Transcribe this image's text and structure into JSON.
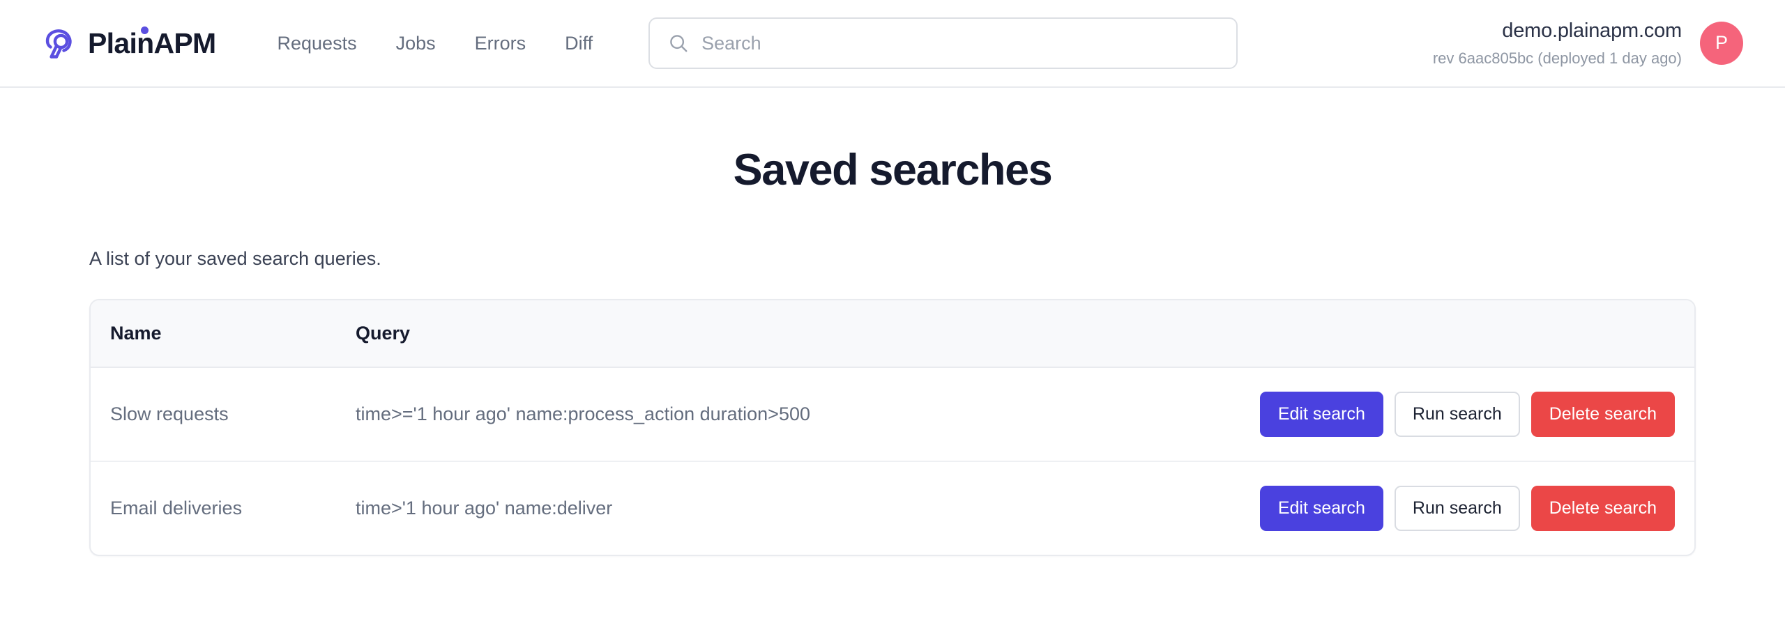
{
  "header": {
    "brand_name": "PlainAPM",
    "brand_logo_icon": "plainapm-logo-icon",
    "nav": [
      {
        "label": "Requests"
      },
      {
        "label": "Jobs"
      },
      {
        "label": "Errors"
      },
      {
        "label": "Diff"
      }
    ],
    "search": {
      "icon": "search-icon",
      "placeholder": "Search",
      "value": ""
    },
    "account": {
      "host": "demo.plainapm.com",
      "revision": "rev 6aac805bc (deployed 1 day ago)",
      "avatar_initial": "P",
      "avatar_color": "#f5647b"
    }
  },
  "main": {
    "title": "Saved searches",
    "description": "A list of your saved search queries.",
    "table": {
      "columns": [
        "Name",
        "Query",
        ""
      ],
      "rows": [
        {
          "name": "Slow requests",
          "query": "time>='1 hour ago' name:process_action duration>500",
          "actions": {
            "edit": "Edit search",
            "run": "Run search",
            "delete": "Delete search"
          }
        },
        {
          "name": "Email deliveries",
          "query": "time>'1 hour ago' name:deliver",
          "actions": {
            "edit": "Edit search",
            "run": "Run search",
            "delete": "Delete search"
          }
        }
      ]
    }
  },
  "colors": {
    "brand_purple": "#5b4fe0",
    "primary_button": "#4a41df",
    "danger_button": "#eb4747",
    "avatar": "#f5647b",
    "text_dark": "#151a2d",
    "text_muted": "#646d7e"
  }
}
